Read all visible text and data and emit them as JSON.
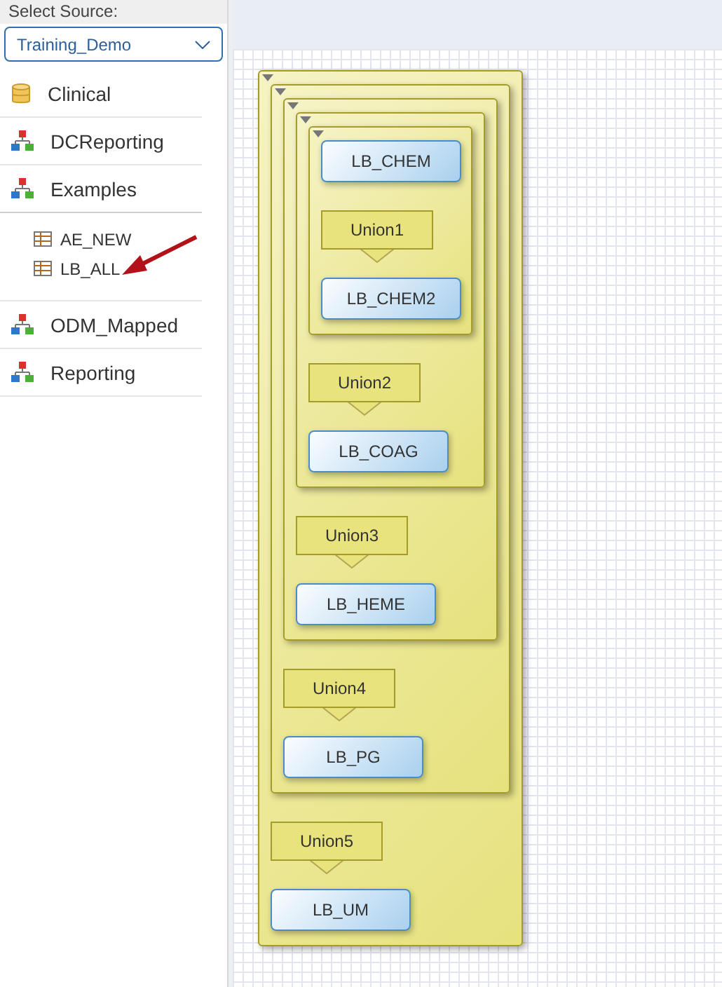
{
  "sidebar": {
    "source_label": "Select Source:",
    "source_value": "Training_Demo",
    "items": [
      {
        "kind": "database",
        "label": "Clinical"
      },
      {
        "kind": "schema",
        "label": "DCReporting"
      },
      {
        "kind": "schema",
        "label": "Examples",
        "expanded": true,
        "children": [
          {
            "kind": "table",
            "label": "AE_NEW"
          },
          {
            "kind": "table",
            "label": "LB_ALL",
            "pointed": true
          }
        ]
      },
      {
        "kind": "schema",
        "label": "ODM_Mapped"
      },
      {
        "kind": "schema",
        "label": "Reporting"
      }
    ]
  },
  "diagram": {
    "kind": "union",
    "label": "Union5",
    "table": "LB_UM",
    "inner": {
      "kind": "union",
      "label": "Union4",
      "table": "LB_PG",
      "inner": {
        "kind": "union",
        "label": "Union3",
        "table": "LB_HEME",
        "inner": {
          "kind": "union",
          "label": "Union2",
          "table": "LB_COAG",
          "inner": {
            "kind": "union",
            "label": "Union1",
            "table": "LB_CHEM2",
            "inner": {
              "kind": "table",
              "table": "LB_CHEM"
            }
          }
        }
      }
    }
  }
}
